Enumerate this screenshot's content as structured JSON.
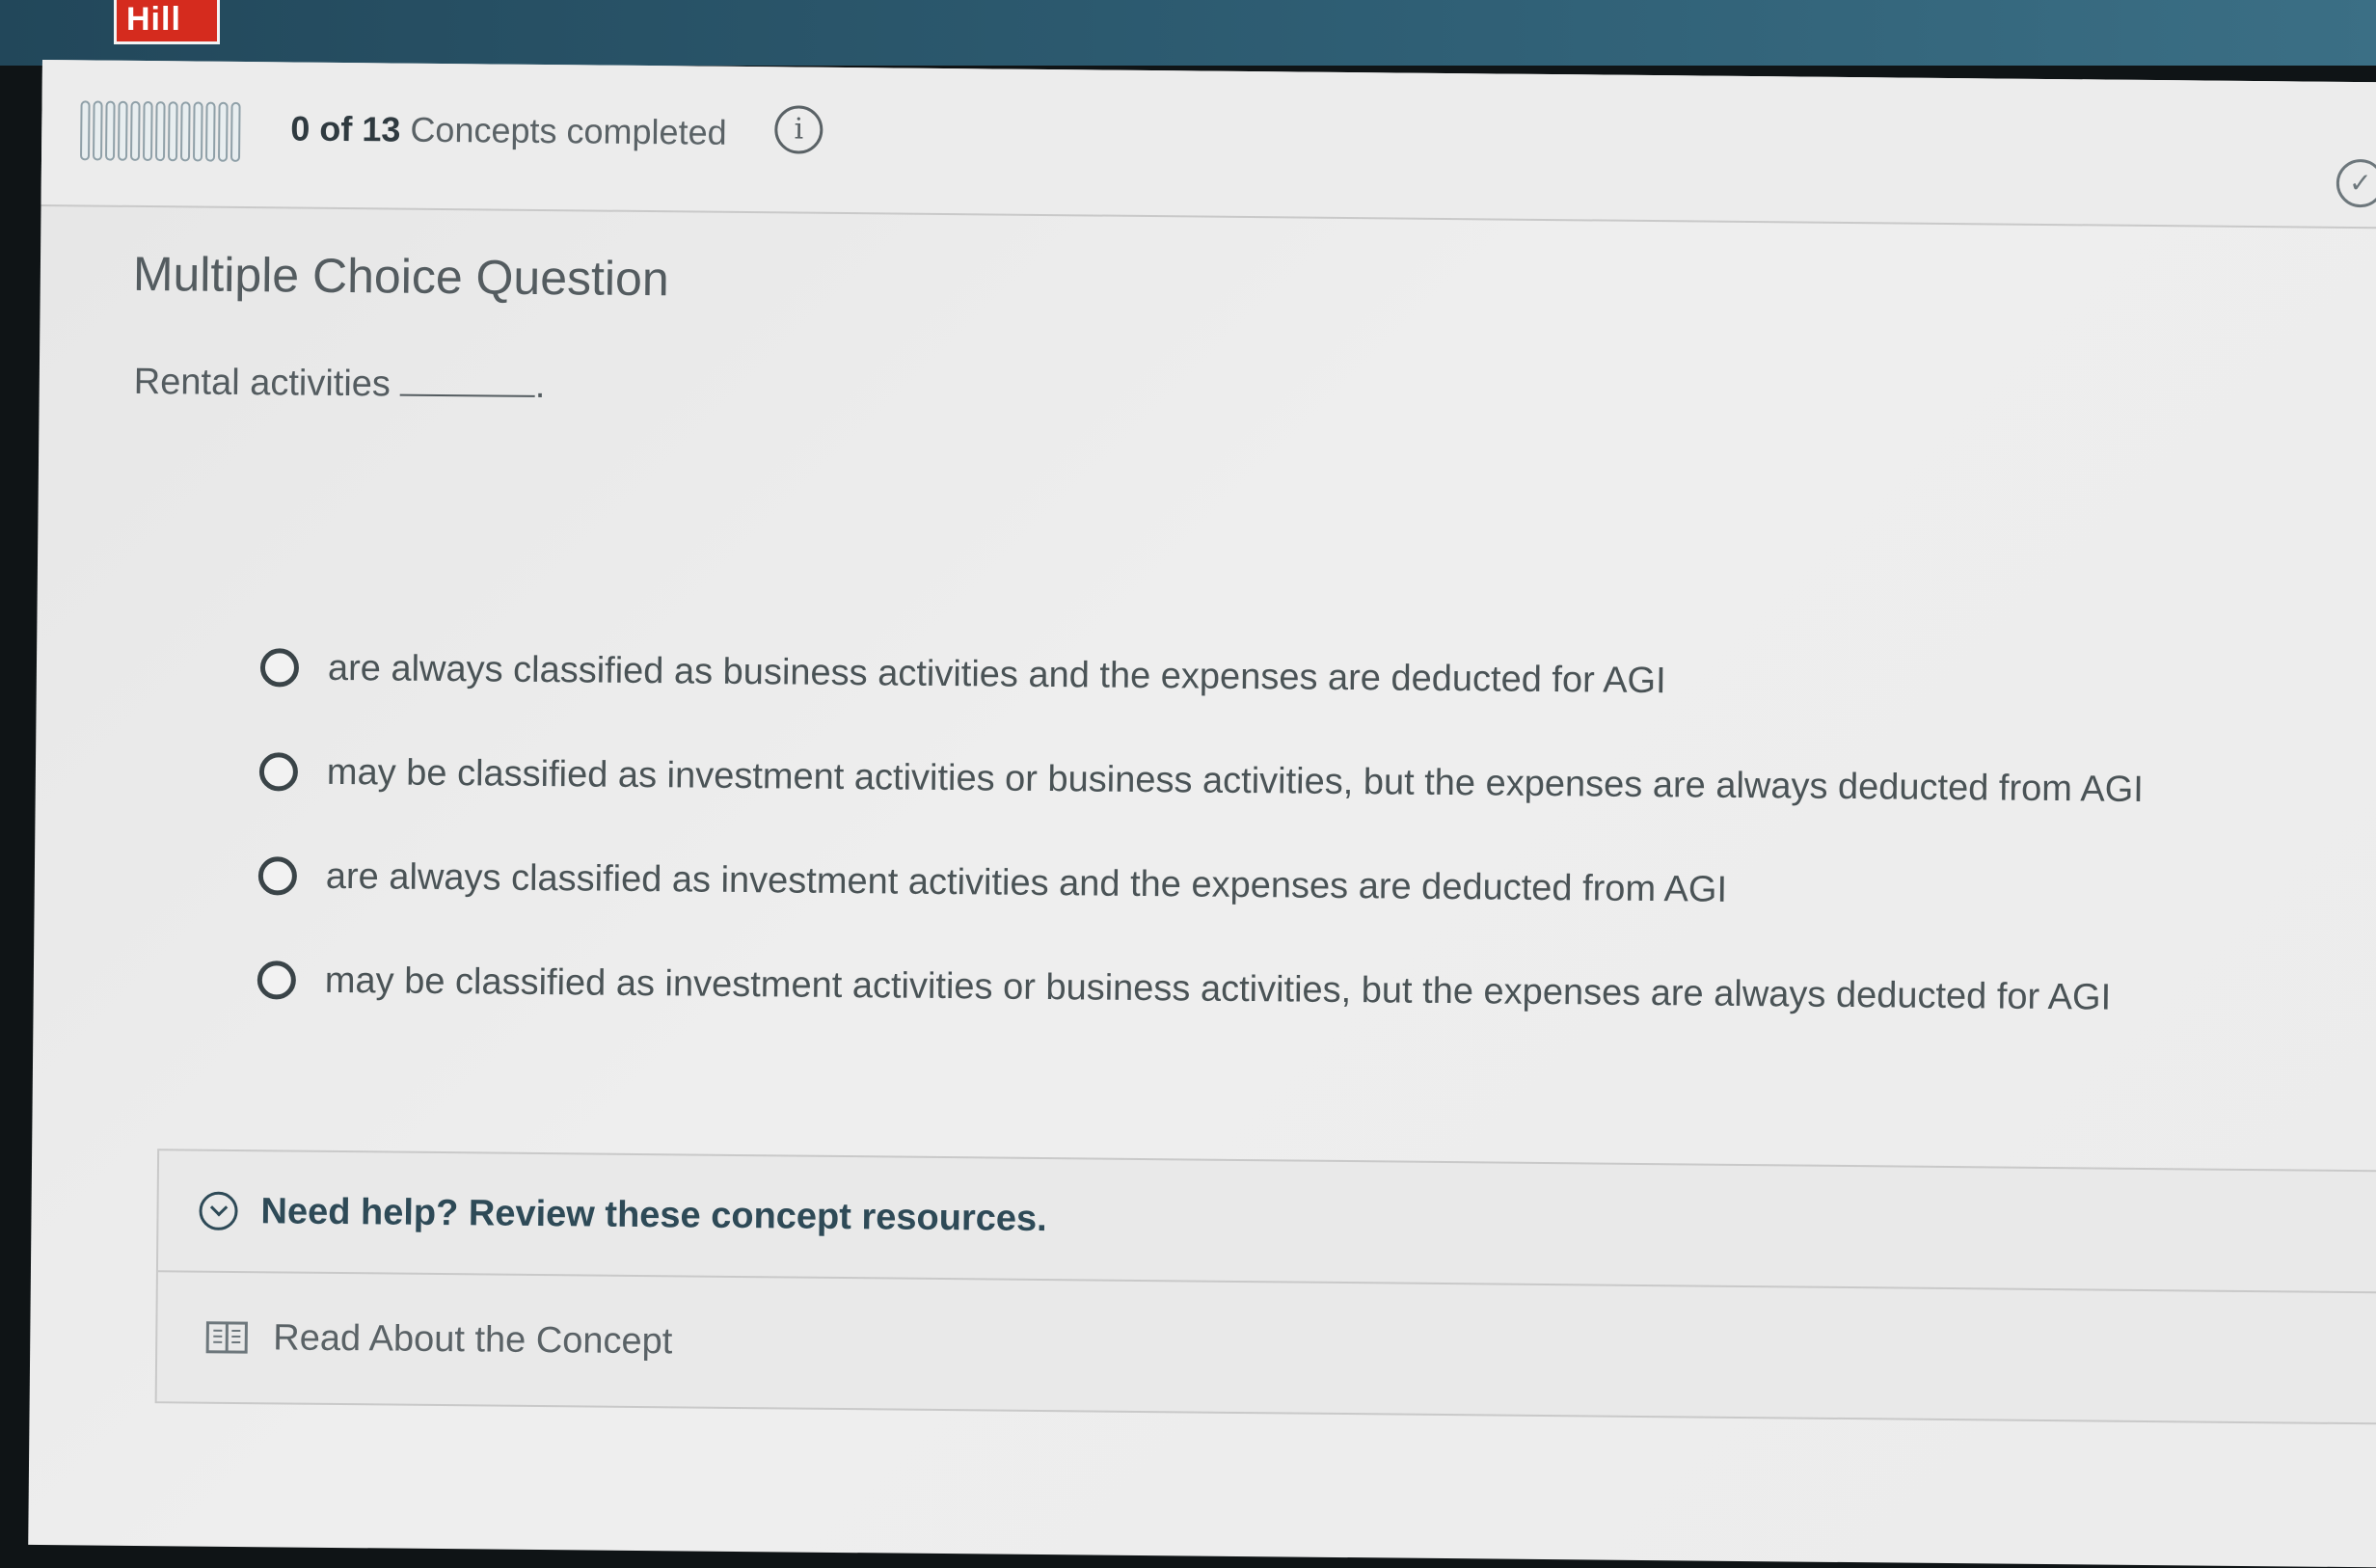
{
  "brand": {
    "logo_text": "Hill",
    "color": "#d52b1e"
  },
  "progress": {
    "completed": "0",
    "of_word": "of",
    "total": "13",
    "label": "Concepts completed",
    "segments": 13,
    "info_icon": "info-icon",
    "check_icon": "checkmark-circle-icon"
  },
  "question": {
    "type_label": "Multiple Choice Question",
    "stem": "Rental activities",
    "stem_suffix": ".",
    "options": [
      {
        "label": "are always classified as business activities and the expenses are deducted for AGI"
      },
      {
        "label": "may be classified as investment activities or business activities, but the expenses are always deducted from AGI"
      },
      {
        "label": "are always classified as investment activities and the expenses are deducted from AGI"
      },
      {
        "label": "may be classified as investment activities or business activities, but the expenses are always deducted for AGI"
      }
    ]
  },
  "help": {
    "title": "Need help? Review these concept resources.",
    "read_label": "Read About the Concept",
    "chevron_icon": "chevron-down-circle-icon",
    "book_icon": "book-icon"
  }
}
